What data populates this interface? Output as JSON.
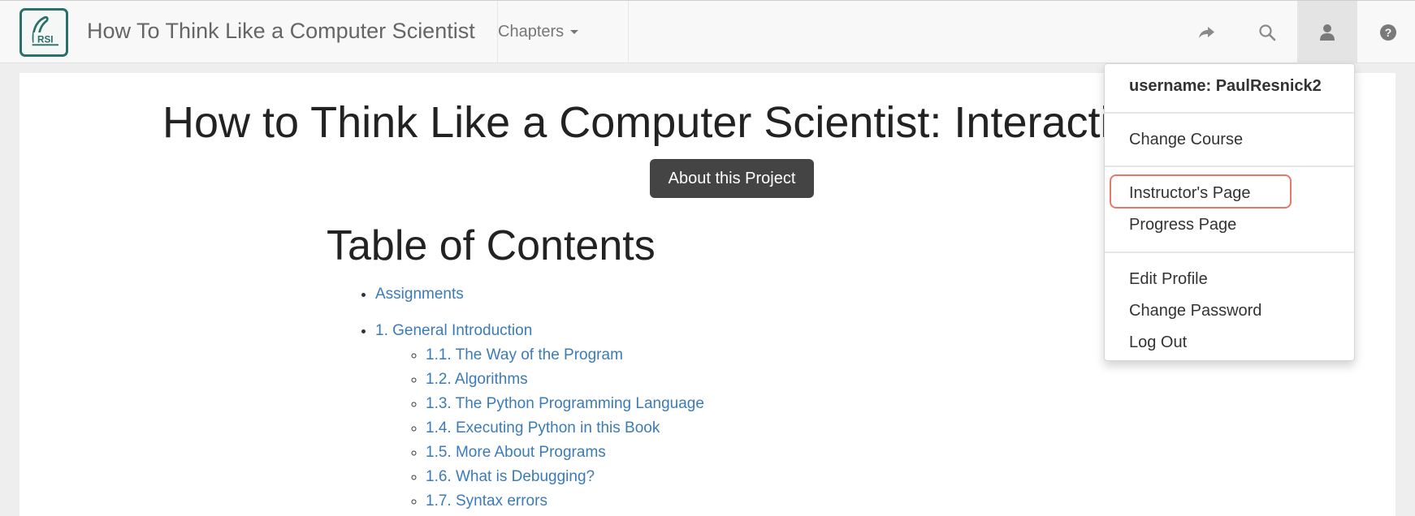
{
  "navbar": {
    "brand_title": "How To Think Like a Computer Scientist",
    "logo_text": "RSI",
    "chapters_label": "Chapters",
    "icons": [
      "share-arrow-icon",
      "search-icon",
      "user-icon",
      "help-icon"
    ]
  },
  "main": {
    "page_title": "How to Think Like a Computer Scientist: Interacti",
    "about_button_label": "About this Project",
    "toc_title": "Table of Contents",
    "toc": [
      {
        "label": "Assignments",
        "children": []
      },
      {
        "label": "1. General Introduction",
        "children": [
          "1.1. The Way of the Program",
          "1.2. Algorithms",
          "1.3. The Python Programming Language",
          "1.4. Executing Python in this Book",
          "1.5. More About Programs",
          "1.6. What is Debugging?",
          "1.7. Syntax errors"
        ]
      }
    ]
  },
  "user_menu": {
    "username_label": "username: PaulResnick2",
    "change_course": "Change Course",
    "instructors_page": "Instructor's Page",
    "progress_page": "Progress Page",
    "edit_profile": "Edit Profile",
    "change_password": "Change Password",
    "log_out": "Log Out"
  },
  "colors": {
    "link": "#3b7bb8",
    "button_bg": "#444444",
    "highlight_border": "#e8776c",
    "logo_border": "#2a6f68"
  }
}
